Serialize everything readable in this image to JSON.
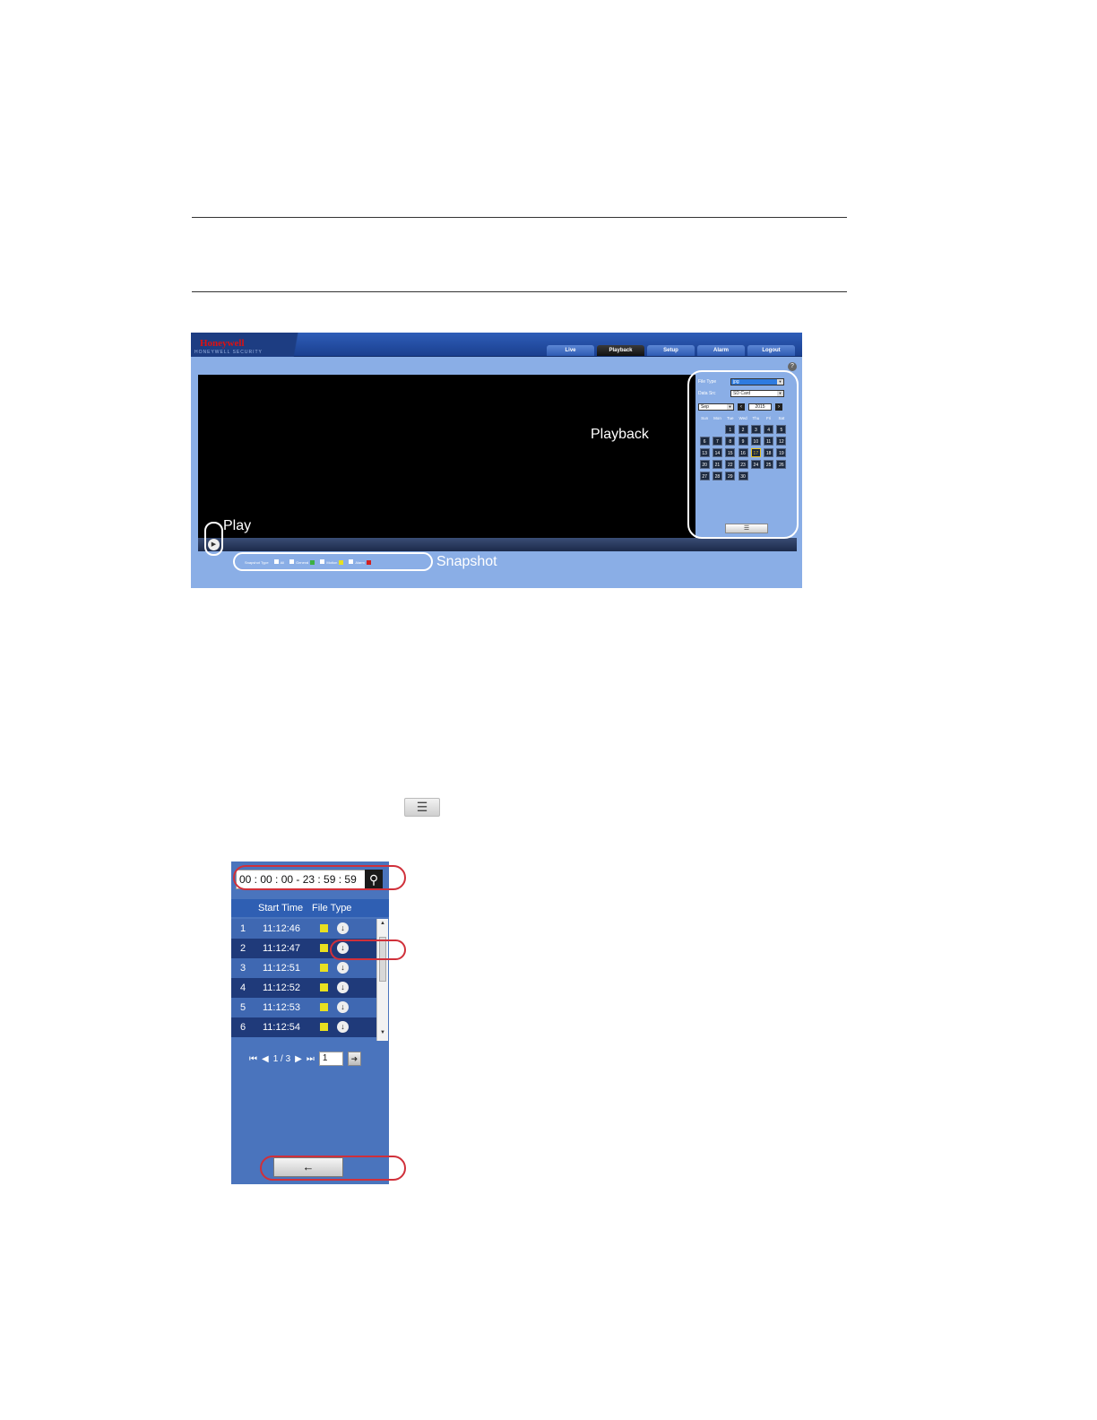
{
  "playback_ui": {
    "logo": "Honeywell",
    "logo_sub": "HONEYWELL SECURITY",
    "tabs": [
      "Live",
      "Playback",
      "Setup",
      "Alarm",
      "Logout"
    ],
    "active_tab": "Playback",
    "help": "?",
    "annotations": {
      "playback": "Playback",
      "play": "Play",
      "snapshot": "Snapshot"
    },
    "panel": {
      "file_type_label": "File Type",
      "file_type_value": "jpg",
      "data_src_label": "Data Src",
      "data_src_value": "SD Card",
      "month": "Sep",
      "year": "2015",
      "weekdays": [
        "Sun",
        "Mon",
        "Tue",
        "Wed",
        "Thu",
        "Fri",
        "Sat"
      ],
      "days": [
        "",
        "",
        "1",
        "2",
        "3",
        "4",
        "5",
        "6",
        "7",
        "8",
        "9",
        "10",
        "11",
        "12",
        "13",
        "14",
        "15",
        "16",
        "17",
        "18",
        "19",
        "20",
        "21",
        "22",
        "23",
        "24",
        "25",
        "26",
        "27",
        "28",
        "29",
        "30"
      ],
      "selected_day": "17"
    },
    "snapshot_types": {
      "label": "Snapshot Type",
      "all": "All",
      "general": "General",
      "motion": "Motion",
      "alarm": "Alarm",
      "colors": {
        "general": "#3cb043",
        "motion": "#e8e020",
        "alarm": "#d21f1f"
      }
    }
  },
  "file_list": {
    "time_range": "00 : 00 : 00 - 23 : 59 : 59",
    "headers": {
      "start_time": "Start Time",
      "file_type": "File Type"
    },
    "rows": [
      {
        "index": "1",
        "time": "11:12:46"
      },
      {
        "index": "2",
        "time": "11:12:47"
      },
      {
        "index": "3",
        "time": "11:12:51"
      },
      {
        "index": "4",
        "time": "11:12:52"
      },
      {
        "index": "5",
        "time": "11:12:53"
      },
      {
        "index": "6",
        "time": "11:12:54"
      }
    ],
    "page_indicator": "1 / 3",
    "page_input": "1"
  }
}
